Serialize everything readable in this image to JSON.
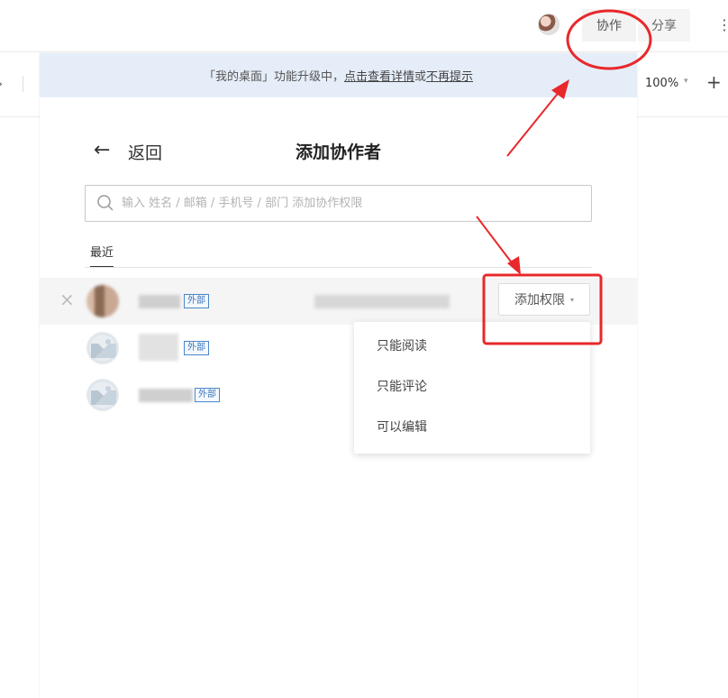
{
  "header": {
    "collab_label": "协作",
    "share_label": "分享",
    "more_glyph": "⋮"
  },
  "toolbar": {
    "zoom": "100%",
    "plus_glyph": "+",
    "chevron_glyph": "›"
  },
  "notice": {
    "prefix": "「我的桌面」功能升级中，",
    "link_details": "点击查看详情",
    "middle": "或",
    "link_dismiss": "不再提示"
  },
  "panel": {
    "back_arrow": "←",
    "back_label": "返回",
    "title": "添加协作者",
    "search_placeholder": "输入 姓名 / 邮箱 / 手机号 / 部门 添加协作权限",
    "tab_recent": "最近"
  },
  "contacts": [
    {
      "tag": "外部"
    },
    {
      "tag": "外部"
    },
    {
      "tag": "外部"
    }
  ],
  "row_close_glyph": "×",
  "permission_button": {
    "label": "添加权限",
    "caret": "▾"
  },
  "permission_menu": {
    "options": [
      "只能阅读",
      "只能评论",
      "可以编辑"
    ]
  },
  "colors": {
    "notice_bg": "#e5edf8",
    "annotation_red": "#e8282b",
    "tag_blue": "#3a77bd"
  }
}
